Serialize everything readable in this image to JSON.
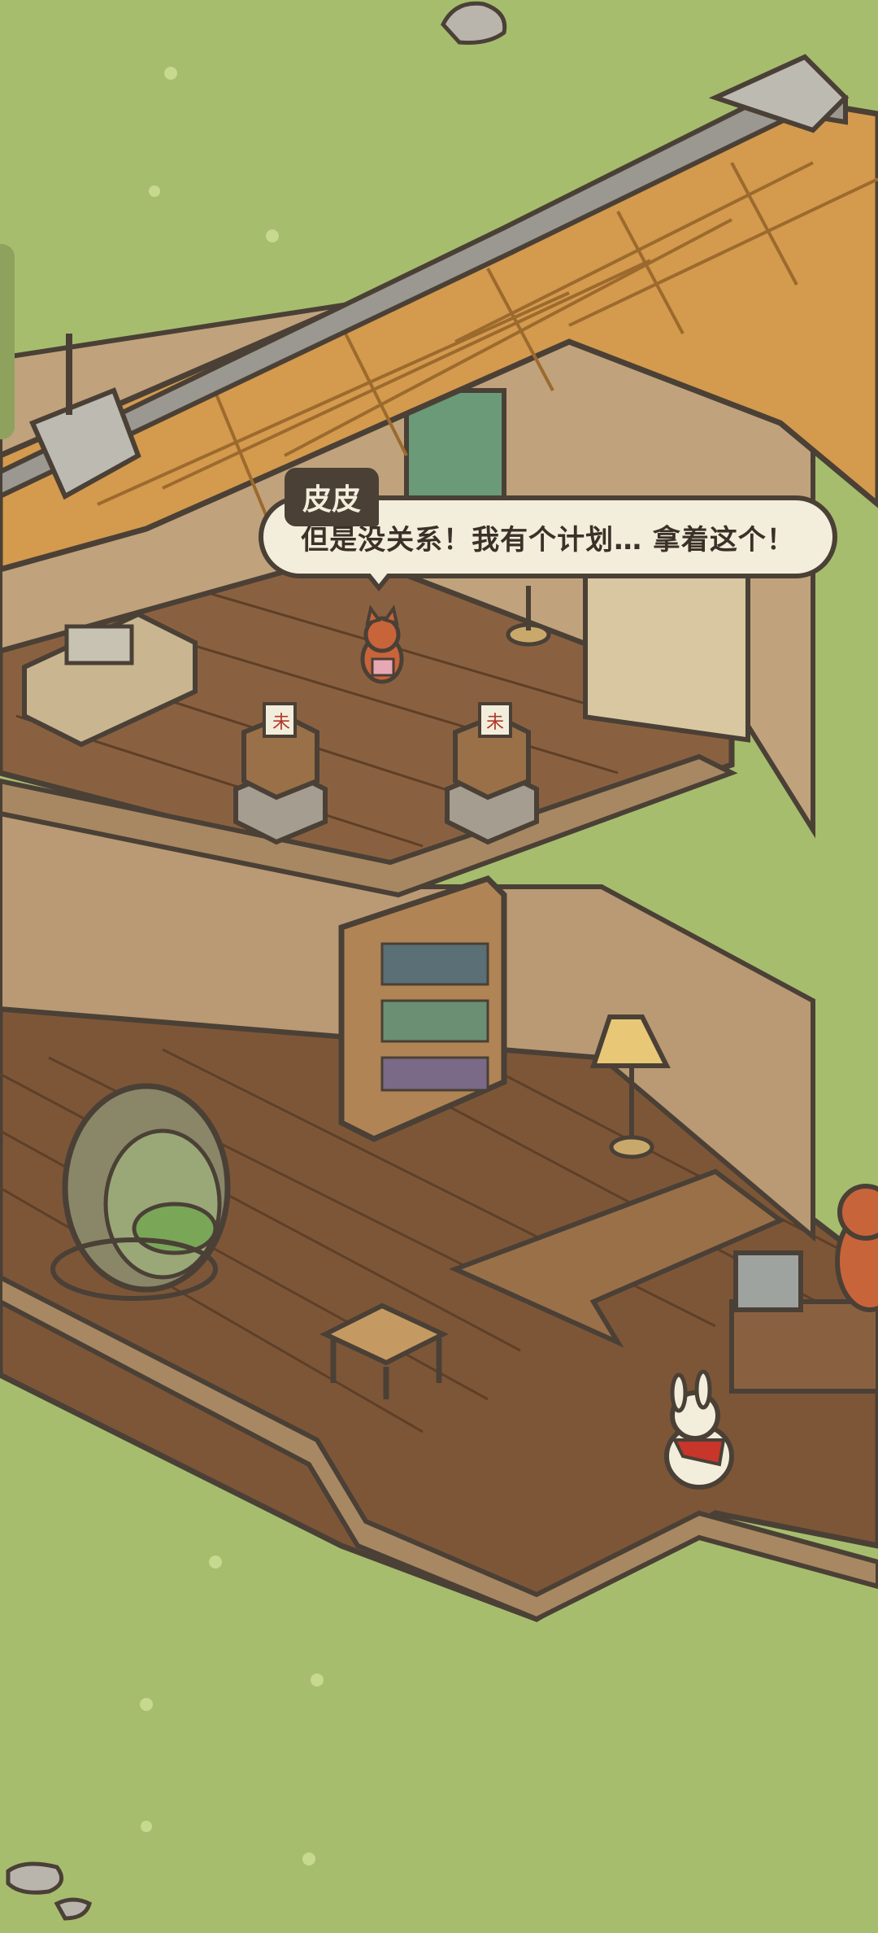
{
  "dialogue": {
    "speaker": "皮皮",
    "text": "但是没关系！我有个计划… 拿着这个！"
  },
  "scene": {
    "signs": [
      "未",
      "未"
    ]
  },
  "colors": {
    "grass": "#a6bd6e",
    "wood_floor": "#8a6140",
    "roof_tile": "#d49a4d",
    "outline": "#4a4036",
    "bubble_fill": "#f3eedc"
  }
}
